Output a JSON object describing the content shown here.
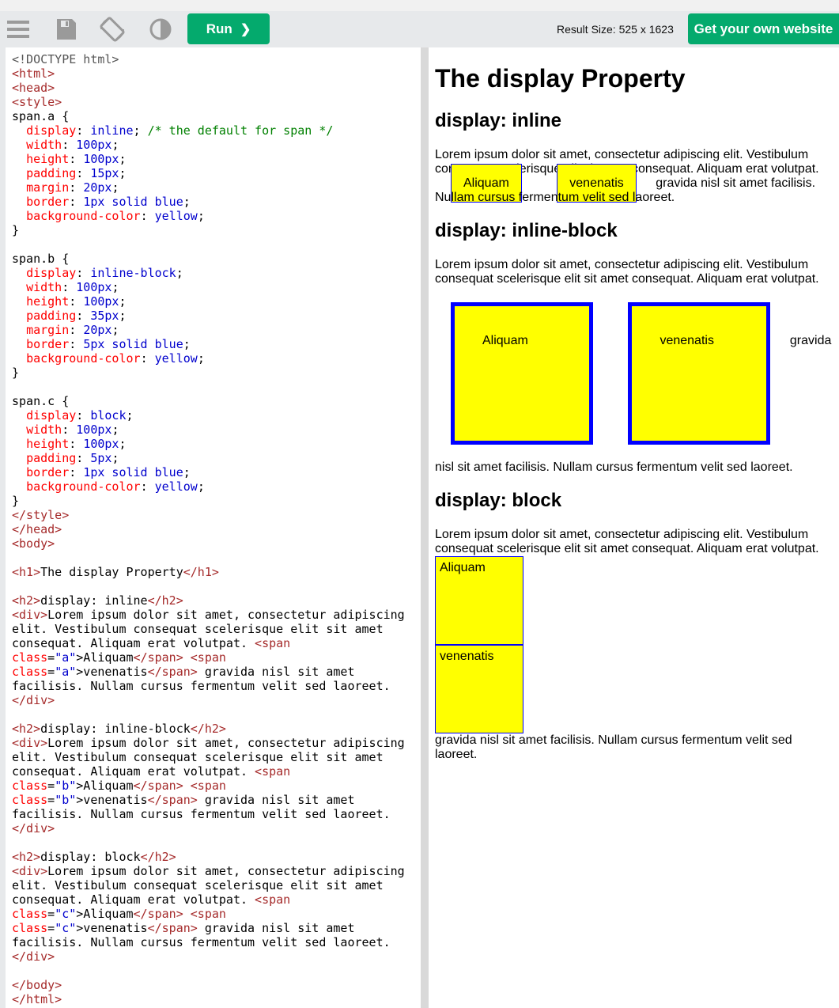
{
  "toolbar": {
    "icons": [
      "menu-icon",
      "save-icon",
      "rotate-icon",
      "contrast-icon"
    ],
    "run_label": "Run",
    "run_chevron": "❯",
    "result_size": "Result Size: 525 x 1623",
    "get_website_label": "Get your own website"
  },
  "editor": {
    "lines": [
      "<!DOCTYPE html>",
      "<html>",
      "<head>",
      "<style>",
      "span.a {",
      "  display: inline; /* the default for span */",
      "  width: 100px;",
      "  height: 100px;",
      "  padding: 15px;",
      "  margin: 20px;",
      "  border: 1px solid blue;",
      "  background-color: yellow;",
      "}",
      "",
      "span.b {",
      "  display: inline-block;",
      "  width: 100px;",
      "  height: 100px;",
      "  padding: 35px;",
      "  margin: 20px;",
      "  border: 5px solid blue;",
      "  background-color: yellow;",
      "}",
      "",
      "span.c {",
      "  display: block;",
      "  width: 100px;",
      "  height: 100px;",
      "  padding: 5px;",
      "  border: 1px solid blue;",
      "  background-color: yellow;",
      "}",
      "</style>",
      "</head>",
      "<body>",
      "",
      "<h1>The display Property</h1>",
      "",
      "<h2>display: inline</h2>",
      "<div>Lorem ipsum dolor sit amet, consectetur adipiscing",
      "elit. Vestibulum consequat scelerisque elit sit amet",
      "consequat. Aliquam erat volutpat. <span",
      "class=\"a\">Aliquam</span> <span",
      "class=\"a\">venenatis</span> gravida nisl sit amet",
      "facilisis. Nullam cursus fermentum velit sed laoreet.",
      "</div>",
      "",
      "<h2>display: inline-block</h2>",
      "<div>Lorem ipsum dolor sit amet, consectetur adipiscing",
      "elit. Vestibulum consequat scelerisque elit sit amet",
      "consequat. Aliquam erat volutpat. <span",
      "class=\"b\">Aliquam</span> <span",
      "class=\"b\">venenatis</span> gravida nisl sit amet",
      "facilisis. Nullam cursus fermentum velit sed laoreet.",
      "</div>",
      "",
      "<h2>display: block</h2>",
      "<div>Lorem ipsum dolor sit amet, consectetur adipiscing",
      "elit. Vestibulum consequat scelerisque elit sit amet",
      "consequat. Aliquam erat volutpat. <span",
      "class=\"c\">Aliquam</span> <span",
      "class=\"c\">venenatis</span> gravida nisl sit amet",
      "facilisis. Nullam cursus fermentum velit sed laoreet.",
      "</div>",
      "",
      "</body>",
      "</html>"
    ]
  },
  "result": {
    "h1": "The display Property",
    "sections": [
      {
        "heading": "display: inline",
        "text_before": "Lorem ipsum dolor sit amet, consectetur adipiscing elit. Vestibulum consequat scelerisque elit sit amet consequat. Aliquam erat volutpat. ",
        "span1": "Aliquam",
        "span2": "venenatis",
        "text_after": " gravida nisl sit amet facilisis. Nullam cursus fermentum velit sed laoreet."
      },
      {
        "heading": "display: inline-block",
        "text_before": "Lorem ipsum dolor sit amet, consectetur adipiscing elit. Vestibulum consequat scelerisque elit sit amet consequat. Aliquam erat volutpat. ",
        "span1": "Aliquam",
        "span2": "venenatis",
        "text_after": " gravida nisl sit amet facilisis. Nullam cursus fermentum velit sed laoreet."
      },
      {
        "heading": "display: block",
        "text_before": "Lorem ipsum dolor sit amet, consectetur adipiscing elit. Vestibulum consequat scelerisque elit sit amet consequat. Aliquam erat volutpat. ",
        "span1": "Aliquam",
        "span2": "venenatis",
        "text_after": " gravida nisl sit amet facilisis. Nullam cursus fermentum velit sed laoreet."
      }
    ]
  },
  "colors": {
    "accent_green": "#04aa6d",
    "code_tag": "#a52a2a",
    "code_attr": "#ff0000",
    "code_value": "#0000cd",
    "code_comment": "#008000"
  }
}
